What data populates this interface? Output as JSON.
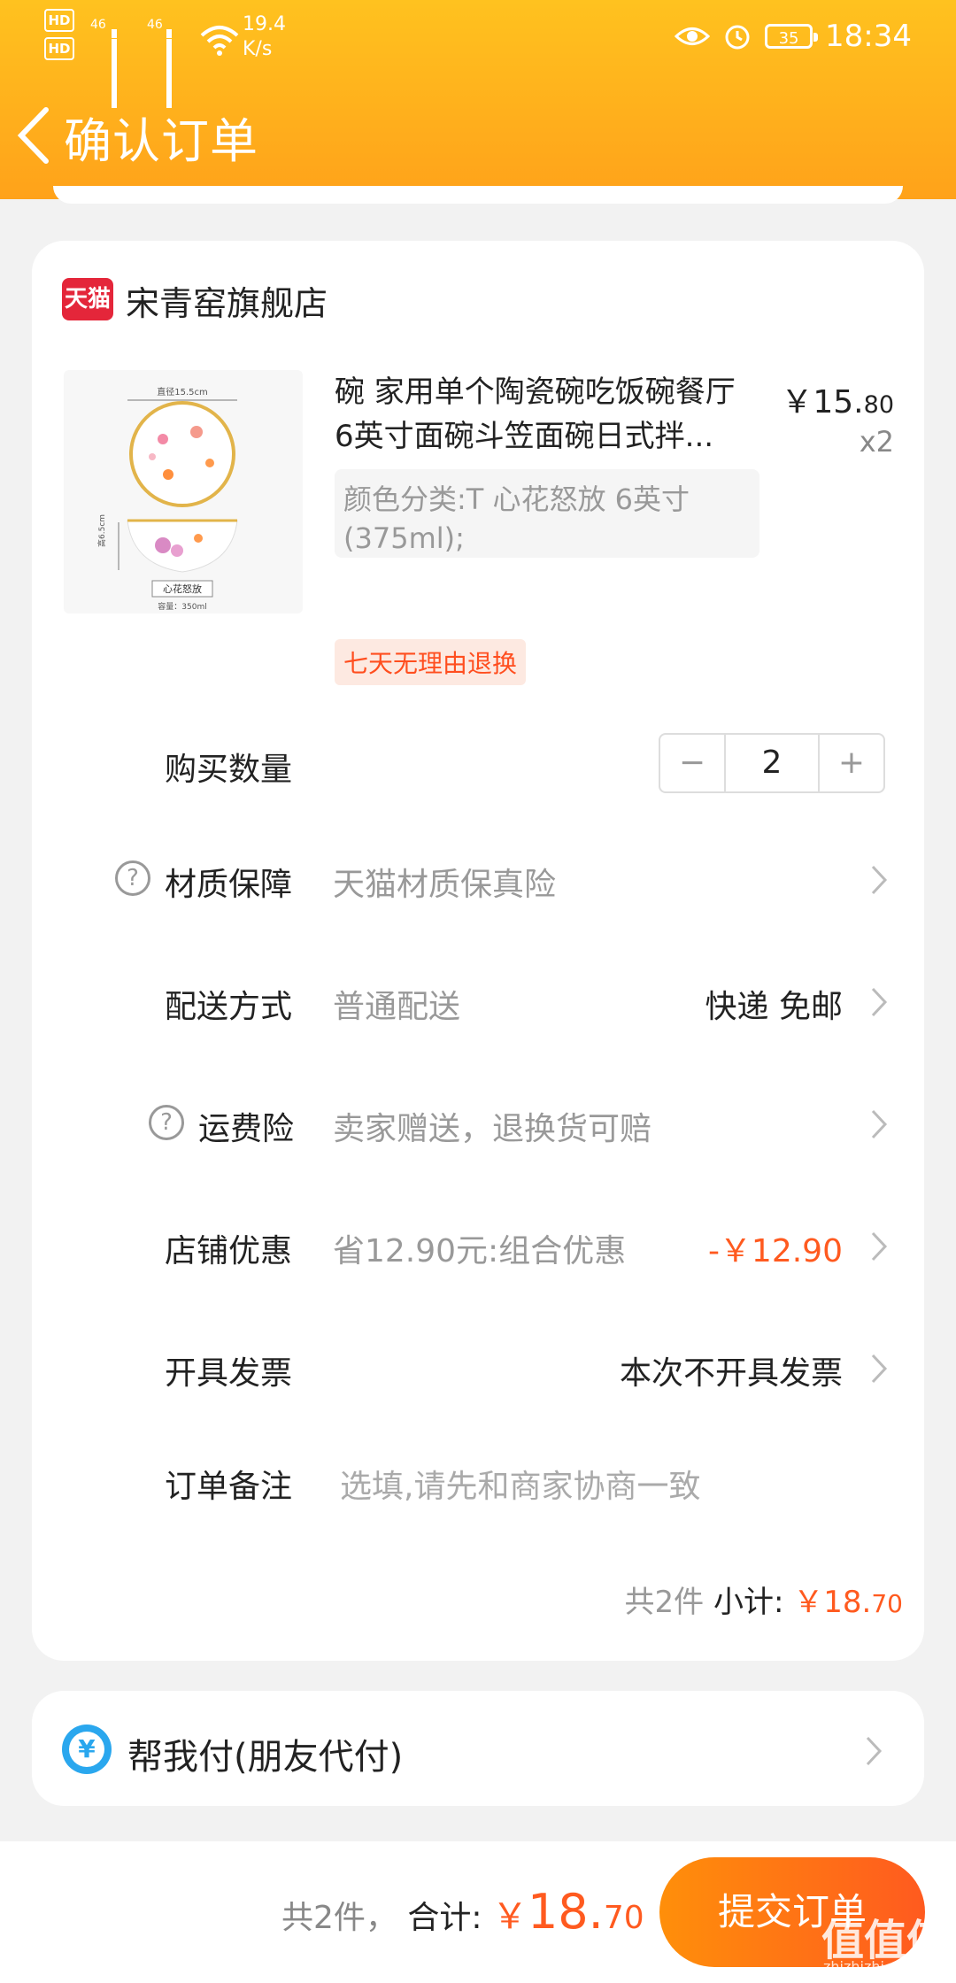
{
  "status_bar": {
    "hd1": "HD",
    "hd2": "HD",
    "sig1": "46",
    "sig2": "46",
    "speed_value": "19.4",
    "speed_unit": "K/s",
    "battery": "35",
    "time": "18:34"
  },
  "header": {
    "title": "确认订单"
  },
  "store": {
    "logo_text": "天猫",
    "name": "宋青窑旗舰店"
  },
  "product": {
    "image_labels": {
      "diameter": "直径15.5cm",
      "height": "高6.5cm",
      "name": "心花怒放",
      "capacity": "容量：350ml"
    },
    "title_line1": "碗 家用单个陶瓷碗吃饭碗餐厅",
    "title_line2": "6英寸面碗斗笠面碗日式拌...",
    "price_main": "￥15.",
    "price_cents": "80",
    "qty": "x2",
    "sku_line1": "颜色分类:T 心花怒放 6英寸",
    "sku_line2": "(375ml);",
    "returns_badge": "七天无理由退换"
  },
  "quantity": {
    "label": "购买数量",
    "minus": "−",
    "value": "2",
    "plus": "+"
  },
  "material": {
    "label": "材质保障",
    "value": "天猫材质保真险"
  },
  "shipping": {
    "label": "配送方式",
    "value": "普通配送",
    "right": "快递 免邮"
  },
  "freight": {
    "label": "运费险",
    "value": "卖家赠送，退换货可赔"
  },
  "discount": {
    "label": "店铺优惠",
    "value": "省12.90元:组合优惠",
    "right": "-￥12.90"
  },
  "invoice": {
    "label": "开具发票",
    "right": "本次不开具发票"
  },
  "remark": {
    "label": "订单备注",
    "placeholder": "选填,请先和商家协商一致"
  },
  "subtotal": {
    "count": "共2件",
    "label": "小计:",
    "currency": "￥",
    "amount": "18.",
    "cents": "70"
  },
  "payment": {
    "label": "帮我付(朋友代付)",
    "icon_char": "¥"
  },
  "bottom": {
    "count": "共2件，",
    "label": "合计:",
    "currency": "￥",
    "amount": "18.",
    "cents": "70",
    "submit": "提交订单"
  },
  "watermark": {
    "text": "值值值",
    "sub": "zhizhizhi.com"
  },
  "colors": {
    "accent": "#ff5a1f",
    "header_top": "#ffc21f",
    "header_bottom": "#ffa21a",
    "tmall_red": "#e4263a"
  }
}
